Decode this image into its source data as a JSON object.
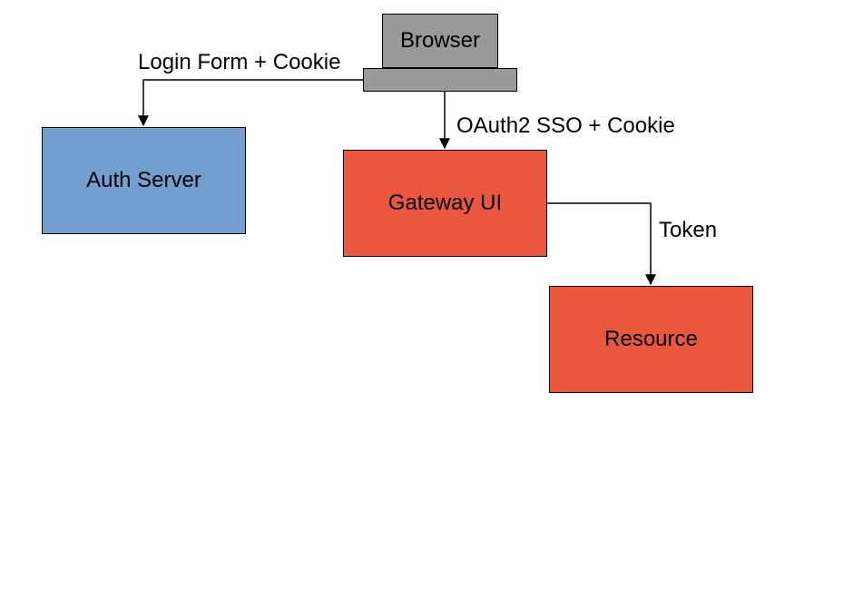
{
  "nodes": {
    "browser": "Browser",
    "auth": "Auth Server",
    "gateway": "Gateway UI",
    "resource": "Resource"
  },
  "edges": {
    "login": "Login Form + Cookie",
    "oauth": "OAuth2 SSO + Cookie",
    "token": "Token"
  }
}
